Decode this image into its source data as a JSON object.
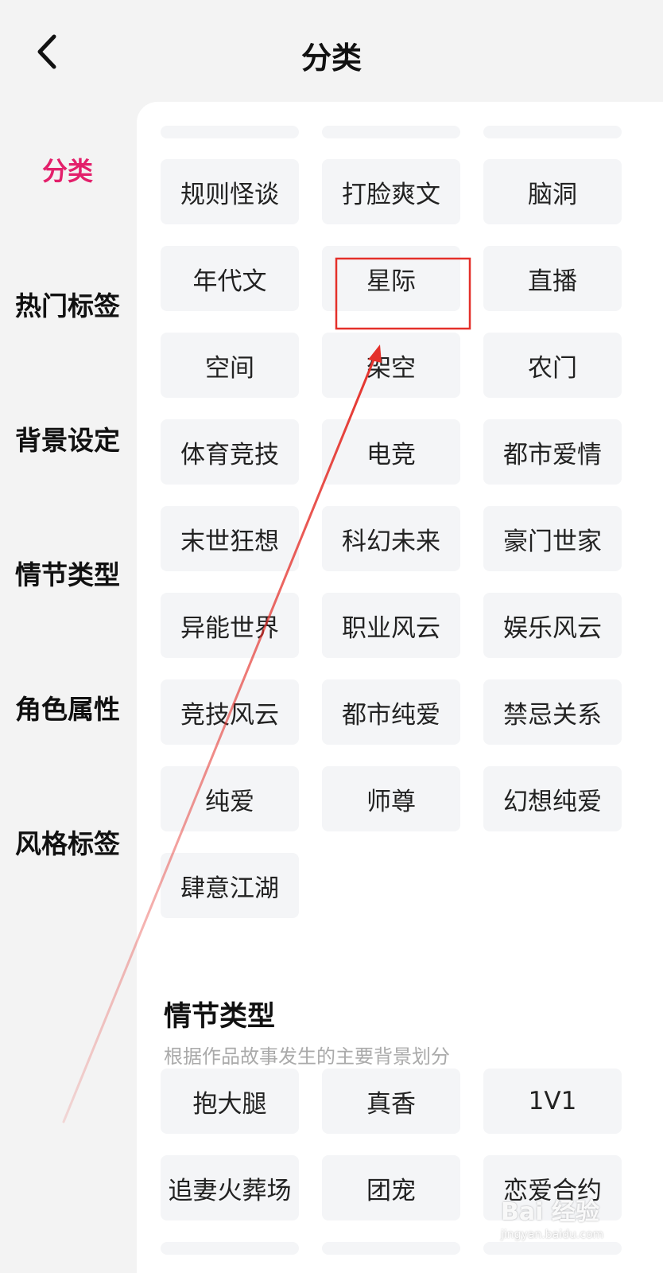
{
  "header": {
    "title": "分类"
  },
  "sidebar": {
    "active_color": "#e3206b",
    "items": [
      {
        "label": "分类"
      },
      {
        "label": "热门标签"
      },
      {
        "label": "背景设定"
      },
      {
        "label": "情节类型"
      },
      {
        "label": "角色属性"
      },
      {
        "label": "风格标签"
      }
    ]
  },
  "category_tags": [
    "规则怪谈",
    "打脸爽文",
    "脑洞",
    "年代文",
    "星际",
    "直播",
    "空间",
    "架空",
    "农门",
    "体育竞技",
    "电竞",
    "都市爱情",
    "末世狂想",
    "科幻未来",
    "豪门世家",
    "异能世界",
    "职业风云",
    "娱乐风云",
    "竞技风云",
    "都市纯爱",
    "禁忌关系",
    "纯爱",
    "师尊",
    "幻想纯爱",
    "肆意江湖"
  ],
  "plot_section": {
    "title": "情节类型",
    "description": "根据作品故事发生的主要背景划分",
    "tags": [
      "抱大腿",
      "真香",
      "1V1",
      "追妻火葬场",
      "团宠",
      "恋爱合约"
    ]
  },
  "annotation": {
    "highlight_color": "#e4302a",
    "arrow_color": "#e4302a"
  },
  "watermark": {
    "main": "Bai 经验",
    "sub": "jingyan.baidu.com"
  }
}
